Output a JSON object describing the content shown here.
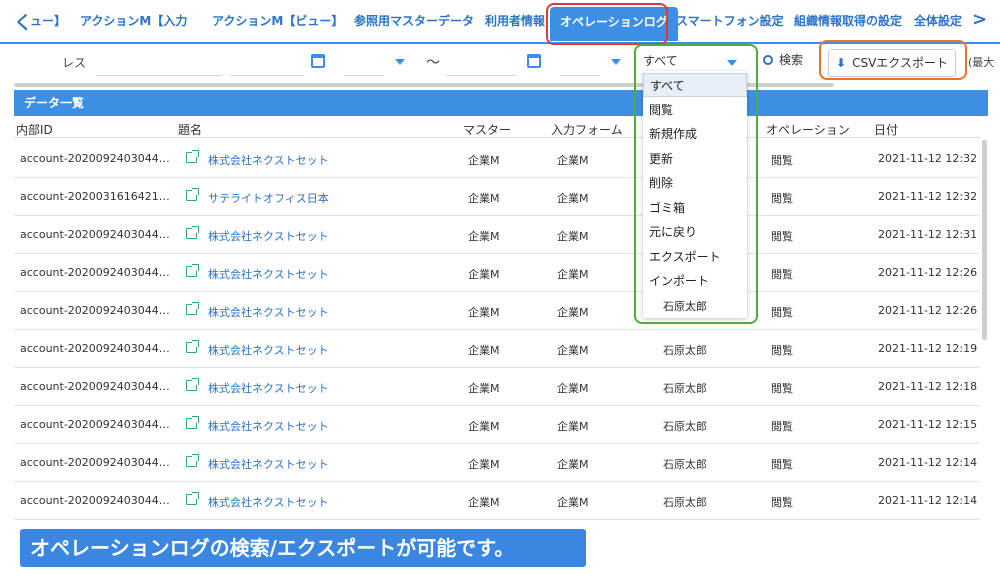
{
  "tabs": {
    "prev_label": "く",
    "items": [
      {
        "label": "ュー】"
      },
      {
        "label": "アクションM【入力"
      },
      {
        "label": "アクションM【ビュー】"
      },
      {
        "label": "参照用マスターデータ"
      },
      {
        "label": "利用者情報"
      },
      {
        "label": "オペレーションログ",
        "active": true
      },
      {
        "label": "スマートフォン設定"
      },
      {
        "label": "組織情報取得の設定"
      },
      {
        "label": "全体設定"
      }
    ],
    "next_label": ">"
  },
  "filter": {
    "label": "レス",
    "range_separator": "〜",
    "operation_select": "すべて",
    "search_label": "検索",
    "csv_label": "CSVエクスポート",
    "trailing_text": "(最大"
  },
  "section_title": "データ一覧",
  "table": {
    "headers": {
      "id": "内部ID",
      "title": "題名",
      "master": "マスター",
      "form": "入力フォーム",
      "operation": "オペレーション",
      "date": "日付"
    },
    "rows": [
      {
        "id": "account-20200924030442…",
        "title": "株式会社ネクストセット",
        "master": "企業M",
        "form": "企業M",
        "user": "",
        "op": "閲覧",
        "date": "2021-11-12 12:32"
      },
      {
        "id": "account-20200316164212…",
        "title": "サテライトオフィス日本",
        "master": "企業M",
        "form": "企業M",
        "user": "",
        "op": "閲覧",
        "date": "2021-11-12 12:32"
      },
      {
        "id": "account-20200924030442…",
        "title": "株式会社ネクストセット",
        "master": "企業M",
        "form": "企業M",
        "user": "",
        "op": "閲覧",
        "date": "2021-11-12 12:31"
      },
      {
        "id": "account-20200924030442…",
        "title": "株式会社ネクストセット",
        "master": "企業M",
        "form": "企業M",
        "user": "",
        "op": "閲覧",
        "date": "2021-11-12 12:26"
      },
      {
        "id": "account-20200924030442…",
        "title": "株式会社ネクストセット",
        "master": "企業M",
        "form": "企業M",
        "user": "",
        "op": "閲覧",
        "date": "2021-11-12 12:26"
      },
      {
        "id": "account-20200924030442…",
        "title": "株式会社ネクストセット",
        "master": "企業M",
        "form": "企業M",
        "user": "石原太郎",
        "op": "閲覧",
        "date": "2021-11-12 12:19"
      },
      {
        "id": "account-20200924030442…",
        "title": "株式会社ネクストセット",
        "master": "企業M",
        "form": "企業M",
        "user": "石原太郎",
        "op": "閲覧",
        "date": "2021-11-12 12:18"
      },
      {
        "id": "account-20200924030442…",
        "title": "株式会社ネクストセット",
        "master": "企業M",
        "form": "企業M",
        "user": "石原太郎",
        "op": "閲覧",
        "date": "2021-11-12 12:15"
      },
      {
        "id": "account-20200924030442…",
        "title": "株式会社ネクストセット",
        "master": "企業M",
        "form": "企業M",
        "user": "石原太郎",
        "op": "閲覧",
        "date": "2021-11-12 12:14"
      },
      {
        "id": "account-20200924030442…",
        "title": "株式会社ネクストセット",
        "master": "企業M",
        "form": "企業M",
        "user": "石原太郎",
        "op": "閲覧",
        "date": "2021-11-12 12:14"
      }
    ]
  },
  "dropdown": {
    "options": [
      "すべて",
      "閲覧",
      "新規作成",
      "更新",
      "削除",
      "ゴミ箱",
      "元に戻り",
      "エクスポート",
      "インポート"
    ],
    "behind_text": "石原太郎"
  },
  "caption": "オペレーションログの検索/エクスポートが可能です。",
  "colors": {
    "accent": "#3d8fe6",
    "link": "#2d73c8",
    "highlight_red": "#e53935",
    "highlight_green": "#4caf3a",
    "highlight_orange": "#e8742a"
  }
}
